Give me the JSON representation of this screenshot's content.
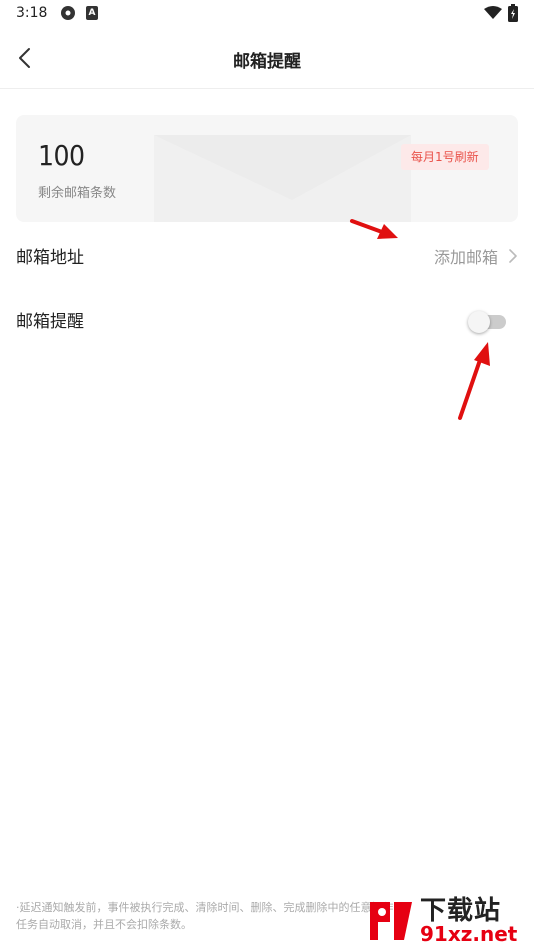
{
  "status_bar": {
    "time": "3:18",
    "icons": [
      "app-icon",
      "a-icon",
      "wifi-icon",
      "battery-icon"
    ],
    "a_glyph": "A"
  },
  "header": {
    "title": "邮箱提醒",
    "back_icon": "back-arrow-icon"
  },
  "quota_card": {
    "count": "100",
    "label": "剩余邮箱条数",
    "refresh_badge": "每月1号刷新",
    "badge_color": "#e9524a"
  },
  "settings": {
    "email_address": {
      "label": "邮箱地址",
      "value": "添加邮箱"
    },
    "email_reminder": {
      "label": "邮箱提醒",
      "enabled": false
    }
  },
  "footnote": {
    "line1": "·延迟通知触发前，事件被执行完成、清除时间、删除、完成删除中的任意操作，",
    "line2": "任务自动取消，并且不会扣除条数。"
  },
  "watermark": {
    "brand_top": "下载站",
    "brand_bottom": "91xz.net",
    "color": "#e60012"
  },
  "annotation_color": "#e01010"
}
